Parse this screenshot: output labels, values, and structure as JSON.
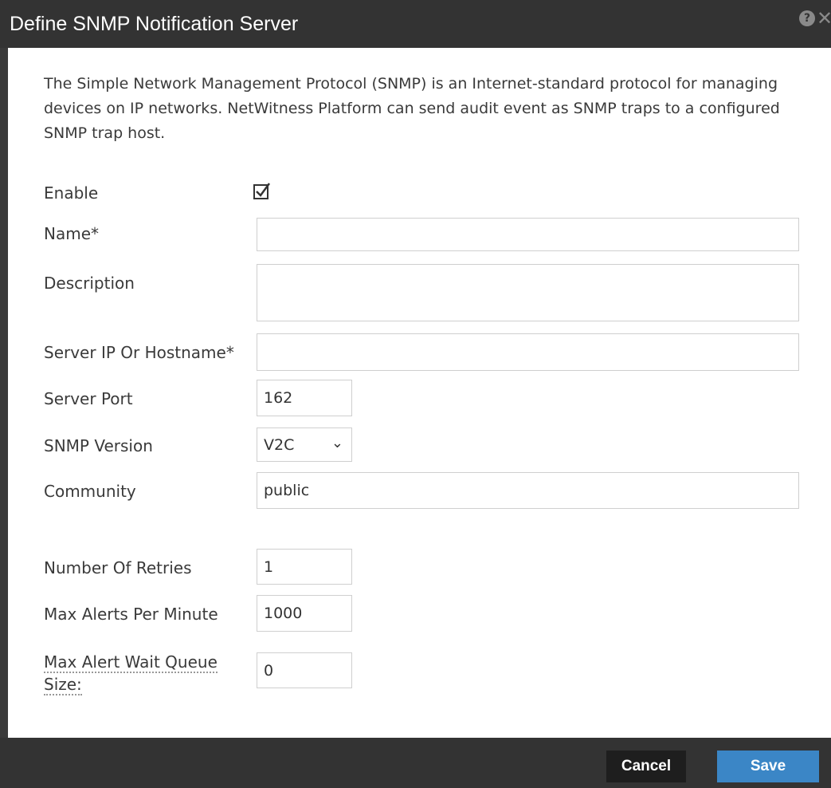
{
  "dialog": {
    "title": "Define SNMP Notification Server",
    "intro": "The Simple Network Management Protocol (SNMP) is an Internet-standard protocol for managing devices on IP networks. NetWitness Platform can send audit event as SNMP traps to a configured SNMP trap host."
  },
  "form": {
    "enable_label": "Enable",
    "enable_checked": true,
    "name_label": "Name*",
    "name_value": "",
    "description_label": "Description",
    "description_value": "",
    "server_label": "Server IP Or Hostname*",
    "server_value": "",
    "port_label": "Server Port",
    "port_value": "162",
    "version_label": "SNMP Version",
    "version_value": "V2C",
    "community_label": "Community",
    "community_value": "public",
    "retries_label": "Number Of Retries",
    "retries_value": "1",
    "max_alerts_label": "Max Alerts Per Minute",
    "max_alerts_value": "1000",
    "queue_label_line1": "Max Alert Wait Queue",
    "queue_label_line2": "Size:",
    "queue_value": "0"
  },
  "footer": {
    "cancel_label": "Cancel",
    "save_label": "Save"
  },
  "icons": {
    "help": "help-icon",
    "close": "close-icon",
    "checkbox": "checkbox-checked-icon",
    "dropdown": "chevron-down-icon"
  },
  "colors": {
    "titlebar": "#333333",
    "save_button": "#3b86c6",
    "cancel_button": "#1e1e1e"
  }
}
